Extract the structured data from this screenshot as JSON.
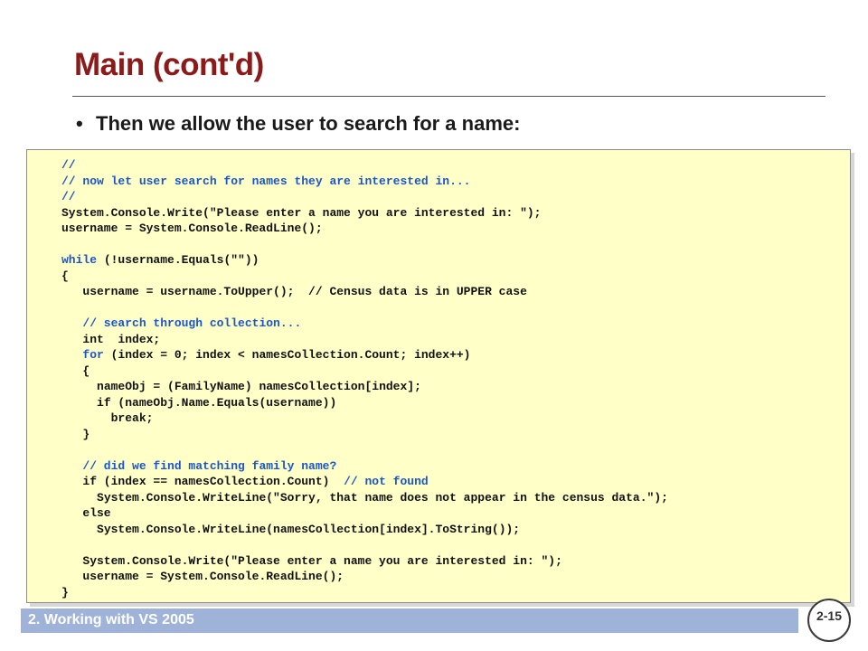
{
  "slide": {
    "title": "Main (cont'd)",
    "bullet": "Then we allow the user to search for a name:",
    "footer": "2. Working with VS 2005",
    "page_number": "2-15"
  },
  "code": [
    {
      "indent": "",
      "segments": [
        {
          "t": "//",
          "k": "c"
        }
      ]
    },
    {
      "indent": "",
      "segments": [
        {
          "t": "// now let user search for names they are interested in...",
          "k": "c"
        }
      ]
    },
    {
      "indent": "",
      "segments": [
        {
          "t": "//",
          "k": "c"
        }
      ]
    },
    {
      "indent": "",
      "segments": [
        {
          "t": "System.Console.Write(\"Please enter a name you are interested in: \");",
          "k": "p"
        }
      ]
    },
    {
      "indent": "",
      "segments": [
        {
          "t": "username = System.Console.ReadLine();",
          "k": "p"
        }
      ]
    },
    {
      "indent": "",
      "segments": []
    },
    {
      "indent": "",
      "segments": [
        {
          "t": "while",
          "k": "k"
        },
        {
          "t": " (!username.Equals(\"\"))",
          "k": "p"
        }
      ]
    },
    {
      "indent": "",
      "segments": [
        {
          "t": "{",
          "k": "p"
        }
      ]
    },
    {
      "indent": "   ",
      "segments": [
        {
          "t": "username = username.ToUpper();  // Census data is in UPPER case",
          "k": "p"
        }
      ]
    },
    {
      "indent": "",
      "segments": []
    },
    {
      "indent": "   ",
      "segments": [
        {
          "t": "// search through collection...",
          "k": "c"
        }
      ]
    },
    {
      "indent": "   ",
      "segments": [
        {
          "t": "int  index;",
          "k": "p"
        }
      ]
    },
    {
      "indent": "   ",
      "segments": [
        {
          "t": "for",
          "k": "k"
        },
        {
          "t": " (index = 0; index < namesCollection.Count; index++)",
          "k": "p"
        }
      ]
    },
    {
      "indent": "   ",
      "segments": [
        {
          "t": "{",
          "k": "p"
        }
      ]
    },
    {
      "indent": "     ",
      "segments": [
        {
          "t": "nameObj = (FamilyName) namesCollection[index];",
          "k": "p"
        }
      ]
    },
    {
      "indent": "     ",
      "segments": [
        {
          "t": "if (nameObj.Name.Equals(username))",
          "k": "p"
        }
      ]
    },
    {
      "indent": "       ",
      "segments": [
        {
          "t": "break;",
          "k": "p"
        }
      ]
    },
    {
      "indent": "   ",
      "segments": [
        {
          "t": "}",
          "k": "p"
        }
      ]
    },
    {
      "indent": "",
      "segments": []
    },
    {
      "indent": "   ",
      "segments": [
        {
          "t": "// did we find matching family name?",
          "k": "c"
        }
      ]
    },
    {
      "indent": "   ",
      "segments": [
        {
          "t": "if (index == namesCollection.Count)  ",
          "k": "p"
        },
        {
          "t": "// not found",
          "k": "c"
        }
      ]
    },
    {
      "indent": "     ",
      "segments": [
        {
          "t": "System.Console.WriteLine(\"Sorry, that name does not appear in the census data.\");",
          "k": "p"
        }
      ]
    },
    {
      "indent": "   ",
      "segments": [
        {
          "t": "else",
          "k": "p"
        }
      ]
    },
    {
      "indent": "     ",
      "segments": [
        {
          "t": "System.Console.WriteLine(namesCollection[index].ToString());",
          "k": "p"
        }
      ]
    },
    {
      "indent": "",
      "segments": []
    },
    {
      "indent": "   ",
      "segments": [
        {
          "t": "System.Console.Write(\"Please enter a name you are interested in: \");",
          "k": "p"
        }
      ]
    },
    {
      "indent": "   ",
      "segments": [
        {
          "t": "username = System.Console.ReadLine();",
          "k": "p"
        }
      ]
    },
    {
      "indent": "",
      "segments": [
        {
          "t": "}",
          "k": "p"
        }
      ]
    }
  ],
  "colors": {
    "title": "#8b1a1a",
    "comment_keyword": "#1c55c8",
    "code_background": "#ffffc8",
    "footer_bar": "#9fb3d9"
  }
}
